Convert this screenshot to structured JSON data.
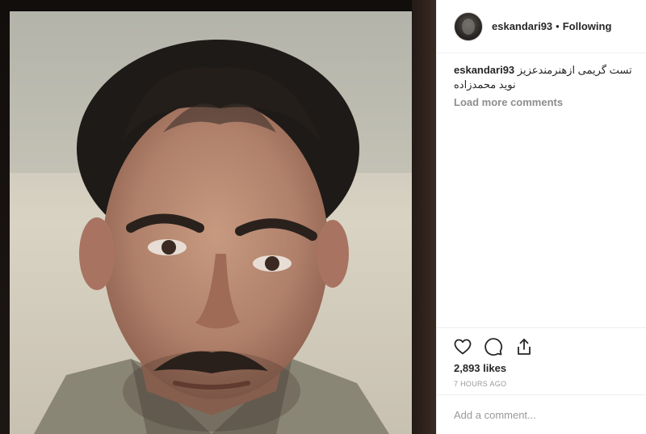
{
  "post": {
    "username": "eskandari93",
    "separator": "•",
    "follow_status": "Following",
    "caption_user": "eskandari93",
    "caption_text": "تست گریمی ازهنرمندعزیز نوید محمدزاده",
    "load_more": "Load more comments",
    "likes": "2,893 likes",
    "time": "7 HOURS AGO",
    "add_comment_placeholder": "Add a comment..."
  },
  "icons": {
    "like": "heart-icon",
    "comment": "comment-icon",
    "share": "share-icon"
  },
  "colors": {
    "text": "#262626",
    "muted": "#8e8e8e",
    "border": "#efefef"
  }
}
